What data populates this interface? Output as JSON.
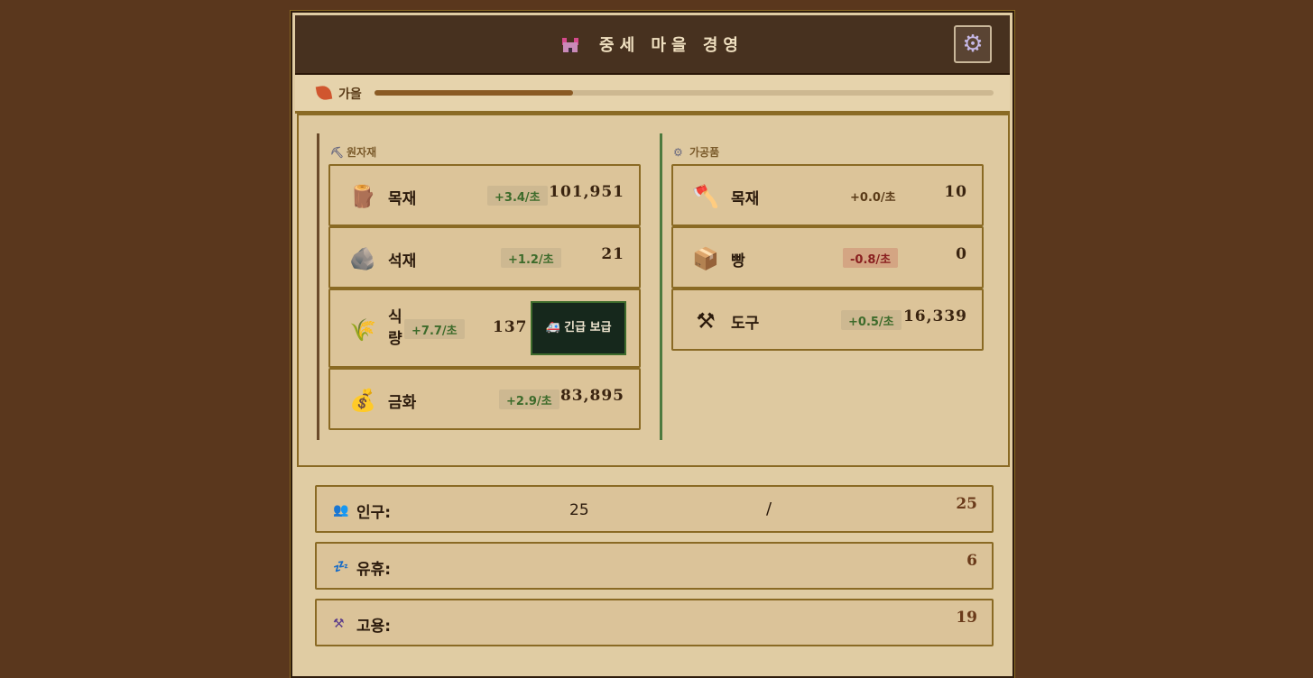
{
  "header": {
    "title": "중세 마을 경영",
    "settings_icon": "gear-icon"
  },
  "season": {
    "label": "가을",
    "progress": 0.32,
    "icon": "autumn-leaf-icon"
  },
  "raw": {
    "heading": "원자재",
    "items": [
      {
        "name": "목재",
        "rate": "+3.4/초",
        "amount": "101,951",
        "icon": "log-icon"
      },
      {
        "name": "석재",
        "rate": "+1.2/초",
        "amount": "21",
        "icon": "rock-icon"
      },
      {
        "name": "식량",
        "rate": "+7.7/초",
        "amount": "137",
        "icon": "wheat-icon",
        "button": "🚑 긴급 보급"
      },
      {
        "name": "금화",
        "rate": "+2.9/초",
        "amount": "83,895",
        "icon": "money-bag-icon"
      }
    ]
  },
  "processed": {
    "heading": "가공품",
    "items": [
      {
        "name": "목재",
        "rate": "+0.0/초",
        "amount": "10",
        "icon": "axe-icon"
      },
      {
        "name": "빵",
        "rate": "-0.8/초",
        "amount": "0",
        "icon": "package-icon"
      },
      {
        "name": "도구",
        "rate": "+0.5/초",
        "amount": "16,339",
        "icon": "hammer-pick-icon"
      }
    ]
  },
  "stats": {
    "population": {
      "label": "인구:",
      "current": "25",
      "separator": "/",
      "max": "25",
      "icon": "people-icon"
    },
    "idle": {
      "label": "유휴:",
      "value": "6",
      "icon": "sleeping-icon"
    },
    "employed": {
      "label": "고용:",
      "value": "19",
      "icon": "tools-icon"
    }
  },
  "colors": {
    "background": "#5a371d",
    "header": "#47311f",
    "panel": "#dec9a0",
    "accent": "#8a6a24",
    "positive": "#3d6b2b",
    "negative": "#8a2020"
  }
}
